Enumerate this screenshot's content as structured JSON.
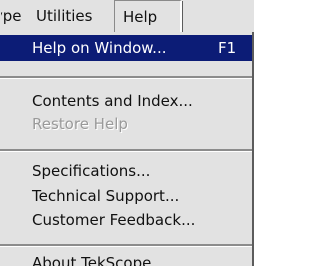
{
  "menubar": {
    "items": [
      {
        "label": "Type"
      },
      {
        "label": "Utilities"
      },
      {
        "label": "Help"
      }
    ]
  },
  "help_menu": {
    "items": [
      {
        "label": "Help on Window...",
        "shortcut": "F1",
        "state": "highlighted"
      },
      {
        "label": "Contents and Index...",
        "state": "enabled"
      },
      {
        "label": "Restore Help",
        "state": "disabled"
      },
      {
        "label": "Specifications...",
        "state": "enabled"
      },
      {
        "label": "Technical Support...",
        "state": "enabled"
      },
      {
        "label": "Customer Feedback...",
        "state": "enabled"
      },
      {
        "label": "About TekScope...",
        "state": "enabled"
      }
    ]
  },
  "colors": {
    "menu_background": "#e2e2e2",
    "highlight": "#0c1c76",
    "disabled_text": "#9a9a9a"
  }
}
